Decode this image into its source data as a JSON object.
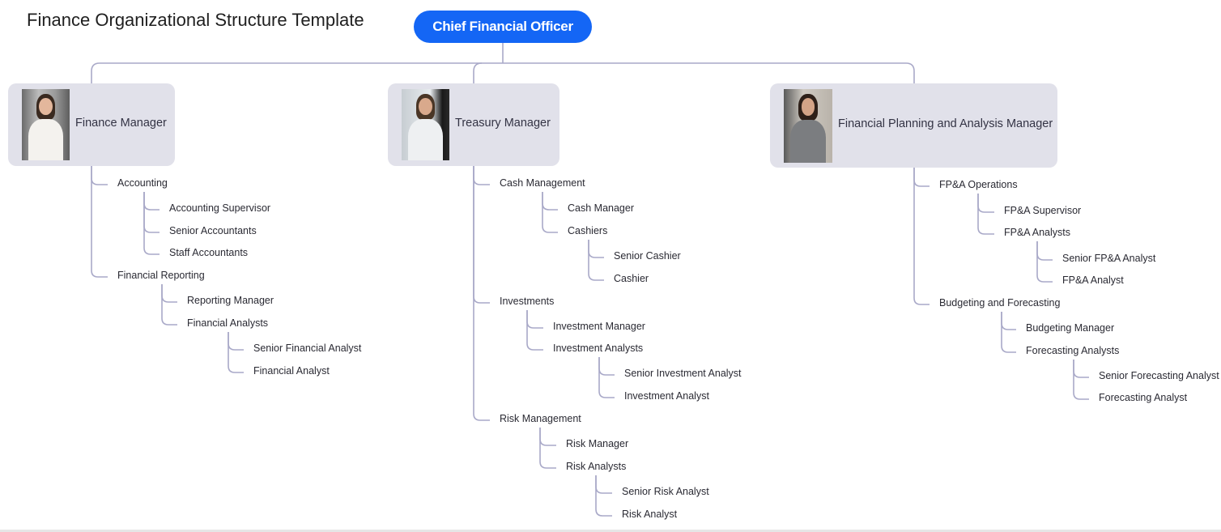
{
  "title": "Finance Organizational Structure Template",
  "root": {
    "label": "Chief Financial Officer",
    "color": "#1466f5"
  },
  "connector_color": "#a9a9c8",
  "card_color": "#e1e1ea",
  "managers": [
    {
      "label": "Finance Manager",
      "photo": "woman-in-white-suit-portrait",
      "groups": [
        {
          "label": "Accounting",
          "children": [
            {
              "label": "Accounting Supervisor",
              "children": []
            },
            {
              "label": "Senior Accountants",
              "children": []
            },
            {
              "label": "Staff Accountants",
              "children": []
            }
          ]
        },
        {
          "label": "Financial Reporting",
          "children": [
            {
              "label": "Reporting Manager",
              "children": []
            },
            {
              "label": "Financial Analysts",
              "children": [
                {
                  "label": "Senior Financial Analyst"
                },
                {
                  "label": "Financial Analyst"
                }
              ]
            }
          ]
        }
      ]
    },
    {
      "label": "Treasury Manager",
      "photo": "man-in-white-shirt-portrait",
      "groups": [
        {
          "label": "Cash Management",
          "children": [
            {
              "label": "Cash Manager",
              "children": []
            },
            {
              "label": "Cashiers",
              "children": [
                {
                  "label": "Senior Cashier"
                },
                {
                  "label": "Cashier"
                }
              ]
            }
          ]
        },
        {
          "label": "Investments",
          "children": [
            {
              "label": "Investment Manager",
              "children": []
            },
            {
              "label": "Investment Analysts",
              "children": [
                {
                  "label": "Senior Investment Analyst"
                },
                {
                  "label": "Investment Analyst"
                }
              ]
            }
          ]
        },
        {
          "label": "Risk Management",
          "children": [
            {
              "label": "Risk Manager",
              "children": []
            },
            {
              "label": "Risk Analysts",
              "children": [
                {
                  "label": "Senior Risk Analyst"
                },
                {
                  "label": "Risk Analyst"
                }
              ]
            }
          ]
        }
      ]
    },
    {
      "label": "Financial Planning and Analysis Manager",
      "photo": "woman-in-grey-suit-portrait",
      "groups": [
        {
          "label": "FP&A Operations",
          "children": [
            {
              "label": "FP&A Supervisor",
              "children": []
            },
            {
              "label": "FP&A Analysts",
              "children": [
                {
                  "label": "Senior FP&A Analyst"
                },
                {
                  "label": "FP&A Analyst"
                }
              ]
            }
          ]
        },
        {
          "label": "Budgeting and Forecasting",
          "children": [
            {
              "label": "Budgeting Manager",
              "children": []
            },
            {
              "label": "Forecasting Analysts",
              "children": [
                {
                  "label": "Senior Forecasting Analyst"
                },
                {
                  "label": "Forecasting Analyst"
                }
              ]
            }
          ]
        }
      ]
    }
  ]
}
